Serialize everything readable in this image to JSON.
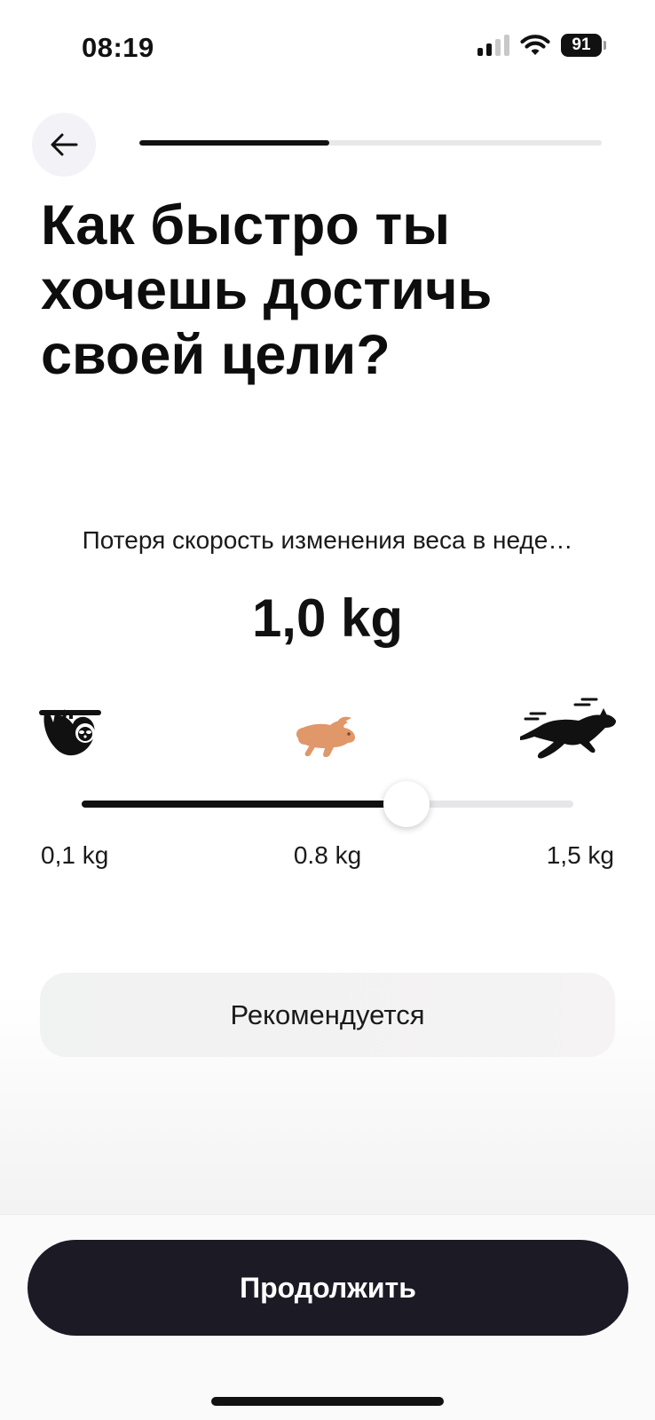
{
  "status_bar": {
    "time": "08:19",
    "battery": "91",
    "icons": [
      "signal-icon",
      "wifi-icon",
      "battery-icon"
    ]
  },
  "header": {
    "back_icon": "arrow-left-icon",
    "progress": 0.41
  },
  "title": "Как быстро ты хочешь достичь своей цели?",
  "subtitle": "Потеря скорость изменения веса в неде…",
  "selected_value": "1,0 kg",
  "speed_icons": [
    "sloth-icon",
    "rabbit-icon",
    "panther-icon"
  ],
  "slider": {
    "min_label": "0,1 kg",
    "mid_label": "0.8 kg",
    "max_label": "1,5 kg",
    "position": 0.66
  },
  "recommended_label": "Рекомендуется",
  "continue_label": "Продолжить",
  "colors": {
    "accent": "#111111",
    "button": "#1c1a24",
    "rabbit": "#e0976a"
  }
}
